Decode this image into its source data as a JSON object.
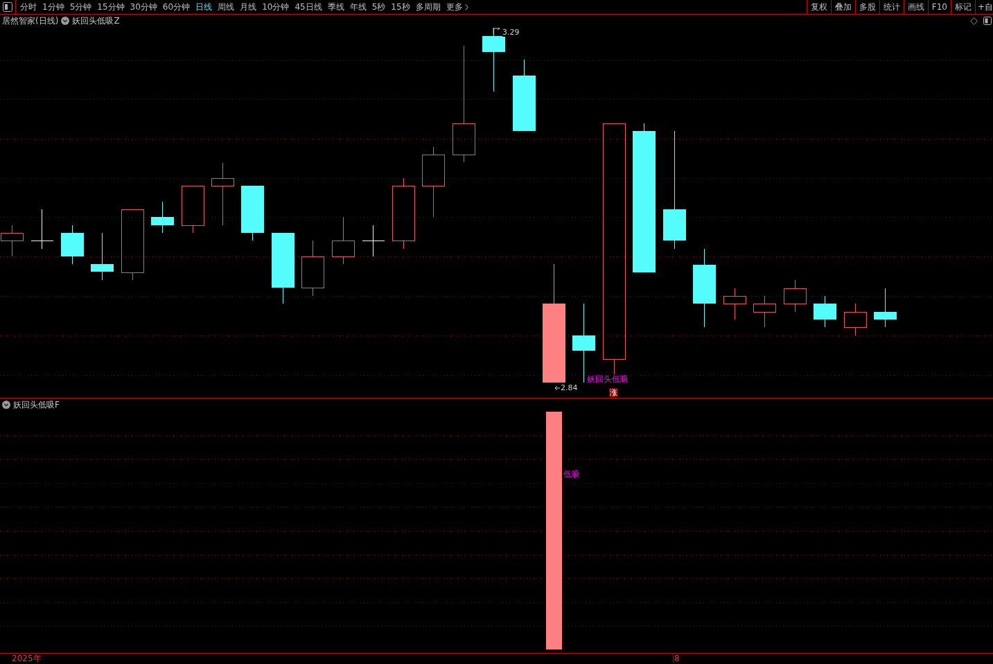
{
  "toolbar": {
    "periods": [
      {
        "label": "分时",
        "selected": false
      },
      {
        "label": "1分钟",
        "selected": false
      },
      {
        "label": "5分钟",
        "selected": false
      },
      {
        "label": "15分钟",
        "selected": false
      },
      {
        "label": "30分钟",
        "selected": false
      },
      {
        "label": "60分钟",
        "selected": false
      },
      {
        "label": "日线",
        "selected": true
      },
      {
        "label": "周线",
        "selected": false
      },
      {
        "label": "月线",
        "selected": false
      },
      {
        "label": "10分钟",
        "selected": false
      },
      {
        "label": "45日线",
        "selected": false
      },
      {
        "label": "季线",
        "selected": false
      },
      {
        "label": "年线",
        "selected": false
      },
      {
        "label": "5秒",
        "selected": false
      },
      {
        "label": "15秒",
        "selected": false
      },
      {
        "label": "多周期",
        "selected": false
      }
    ],
    "more": "更多",
    "tools": [
      "复权",
      "叠加",
      "多股",
      "统计",
      "画线",
      "F10",
      "标记",
      "+自"
    ]
  },
  "main_panel": {
    "title": "居然智家(日线)",
    "indicator": "妖回头低吸Z",
    "high_label": "3.29",
    "low_label": "2.84",
    "signal_label": "妖回头低吸",
    "marker": "涨"
  },
  "sub_panel": {
    "indicator": "妖回头低吸F",
    "signal_label": "低吸"
  },
  "time_axis": {
    "labels": [
      "2025年",
      "8"
    ]
  }
}
